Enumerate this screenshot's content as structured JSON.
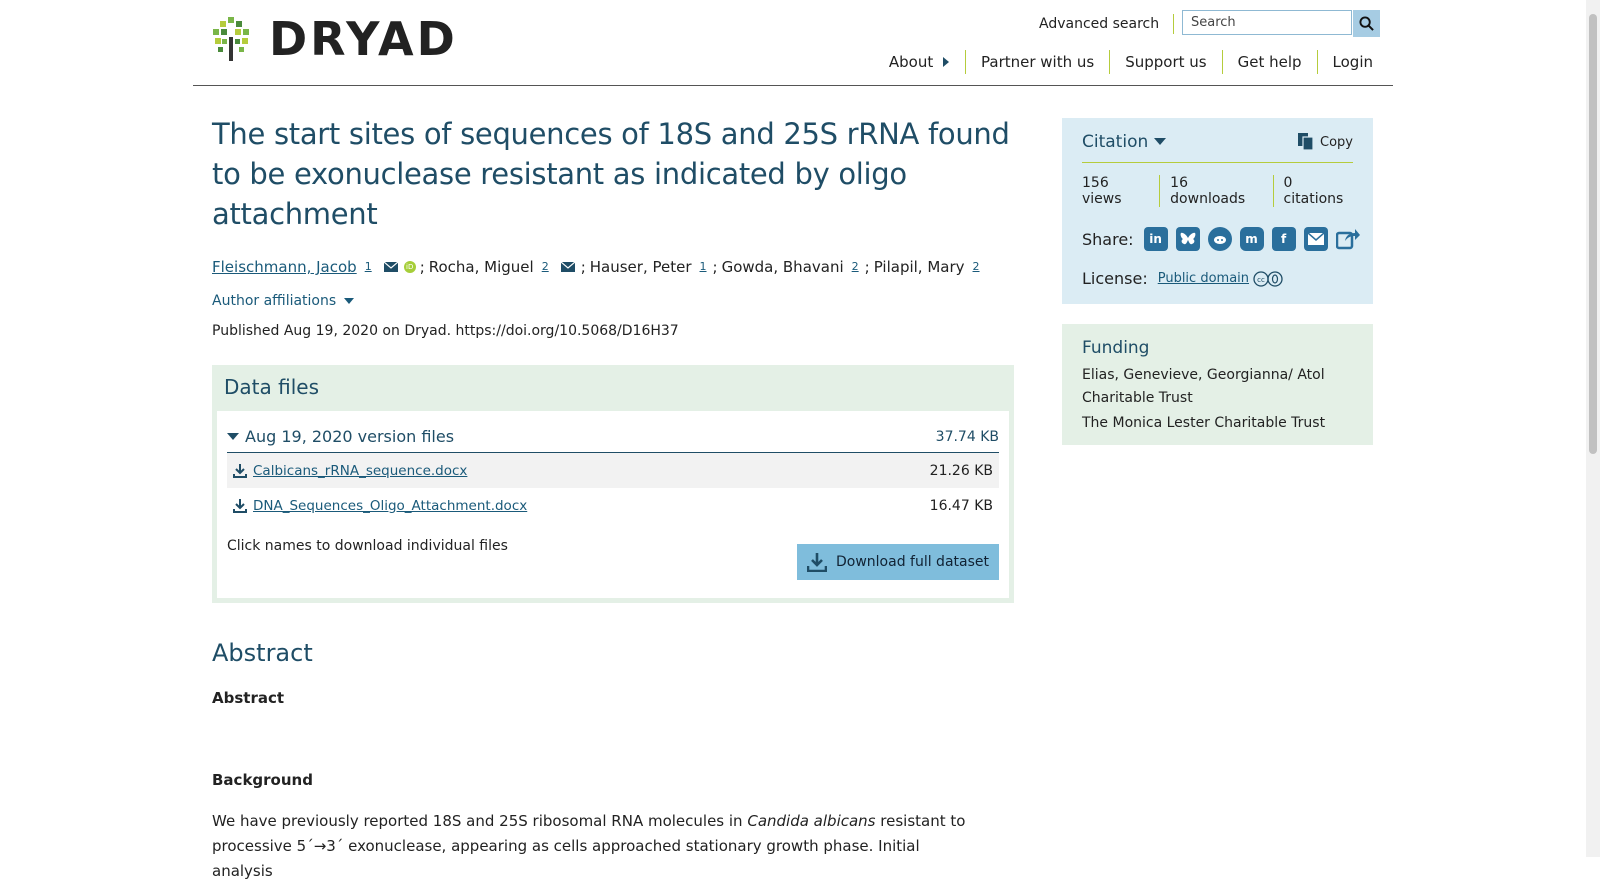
{
  "header": {
    "logo_text": "DRYAD",
    "advanced_search": "Advanced search",
    "search_placeholder": "Search",
    "nav": [
      "About",
      "Partner with us",
      "Support us",
      "Get help",
      "Login"
    ]
  },
  "dataset": {
    "title": "The start sites of sequences of 18S and 25S rRNA found to be exonuclease resistant as indicated by oligo attachment",
    "authors": [
      {
        "name": "Fleischmann, Jacob",
        "sup": "1"
      },
      {
        "name": "Rocha, Miguel",
        "sup": "2"
      },
      {
        "name": "Hauser, Peter",
        "sup": "1"
      },
      {
        "name": "Gowda, Bhavani",
        "sup": "2"
      },
      {
        "name": "Pilapil, Mary",
        "sup": "2"
      }
    ],
    "separator": ";",
    "author_affiliations": "Author affiliations",
    "published": "Published Aug 19, 2020 on Dryad. https://doi.org/10.5068/D16H37"
  },
  "data_files": {
    "title": "Data files",
    "version_label": "Aug 19, 2020 version files",
    "version_size": "37.74 KB",
    "files": [
      {
        "name": "Calbicans_rRNA_sequence.docx",
        "size": "21.26 KB"
      },
      {
        "name": "DNA_Sequences_Oligo_Attachment.docx",
        "size": "16.47 KB"
      }
    ],
    "hint": "Click names to download individual files",
    "download_button": "Download full dataset"
  },
  "abstract": {
    "heading": "Abstract",
    "subheading": "Abstract",
    "background_heading": "Background",
    "para_part1": "We have previously reported 18S and 25S ribosomal RNA molecules in ",
    "para_italic": "Candida albicans",
    "para_part2": " resistant to",
    "para_line2": "processive 5´→3´ exonuclease, appearing as cells approached stationary growth phase. Initial analysis"
  },
  "citation": {
    "title": "Citation",
    "copy": "Copy",
    "views": "156 views",
    "downloads": "16 downloads",
    "citations": "0 citations",
    "share_label": "Share:",
    "share_icons": [
      "linkedin-icon",
      "bluesky-icon",
      "reddit-icon",
      "mastodon-icon",
      "facebook-icon",
      "email-icon",
      "share-icon"
    ],
    "license_label": "License:",
    "license_value": "Public domain"
  },
  "funding": {
    "title": "Funding",
    "items": [
      "Elias, Genevieve, Georgianna/ Atol Charitable Trust",
      "The Monica Lester Charitable Trust"
    ]
  },
  "colors": {
    "primary": "#1f4d66",
    "link": "#1a5a7a",
    "accent_green": "#b5cc3c",
    "citation_bg": "#dbecf4",
    "funding_bg": "#e4f0e6",
    "button_bg": "#7fbddc"
  }
}
